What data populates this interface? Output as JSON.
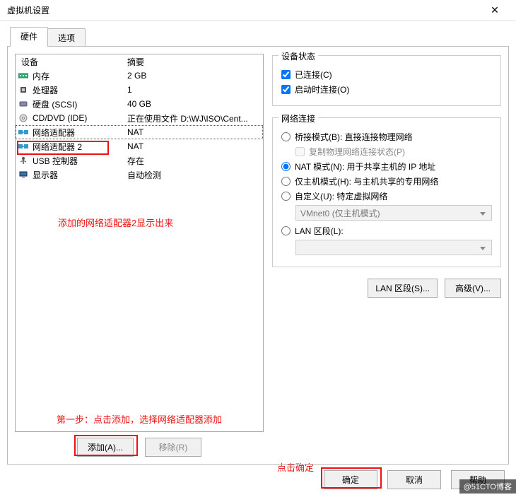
{
  "window": {
    "title": "虚拟机设置",
    "close": "✕"
  },
  "tabs": {
    "hw": "硬件",
    "opt": "选项"
  },
  "headers": {
    "device": "设备",
    "summary": "摘要"
  },
  "devices": [
    {
      "icon": "memory",
      "name": "内存",
      "summary": "2 GB"
    },
    {
      "icon": "cpu",
      "name": "处理器",
      "summary": "1"
    },
    {
      "icon": "disk",
      "name": "硬盘 (SCSI)",
      "summary": "40 GB"
    },
    {
      "icon": "cd",
      "name": "CD/DVD (IDE)",
      "summary": "正在使用文件 D:\\WJ\\ISO\\Cent..."
    },
    {
      "icon": "net",
      "name": "网络适配器",
      "summary": "NAT"
    },
    {
      "icon": "net",
      "name": "网络适配器 2",
      "summary": "NAT"
    },
    {
      "icon": "usb",
      "name": "USB 控制器",
      "summary": "存在"
    },
    {
      "icon": "display",
      "name": "显示器",
      "summary": "自动检测"
    }
  ],
  "left_buttons": {
    "add": "添加(A)...",
    "remove": "移除(R)"
  },
  "status_group": {
    "title": "设备状态",
    "connected": "已连接(C)",
    "connect_on": "启动时连接(O)"
  },
  "net_group": {
    "title": "网络连接",
    "bridged": "桥接模式(B): 直接连接物理网络",
    "replicate": "复制物理网络连接状态(P)",
    "nat": "NAT 模式(N): 用于共享主机的 IP 地址",
    "hostonly": "仅主机模式(H): 与主机共享的专用网络",
    "custom": "自定义(U): 特定虚拟网络",
    "combo_custom": "VMnet0 (仅主机模式)",
    "lan": "LAN 区段(L):",
    "combo_lan": ""
  },
  "right_buttons": {
    "lan_seg": "LAN 区段(S)...",
    "advanced": "高级(V)..."
  },
  "dialog_buttons": {
    "ok": "确定",
    "cancel": "取消",
    "help": "帮助"
  },
  "annotations": {
    "adapter2": "添加的网络适配器2显示出来",
    "step1": "第一步：点击添加，选择网络适配器添加",
    "click_ok": "点击确定"
  },
  "watermark": "@51CTO博客"
}
